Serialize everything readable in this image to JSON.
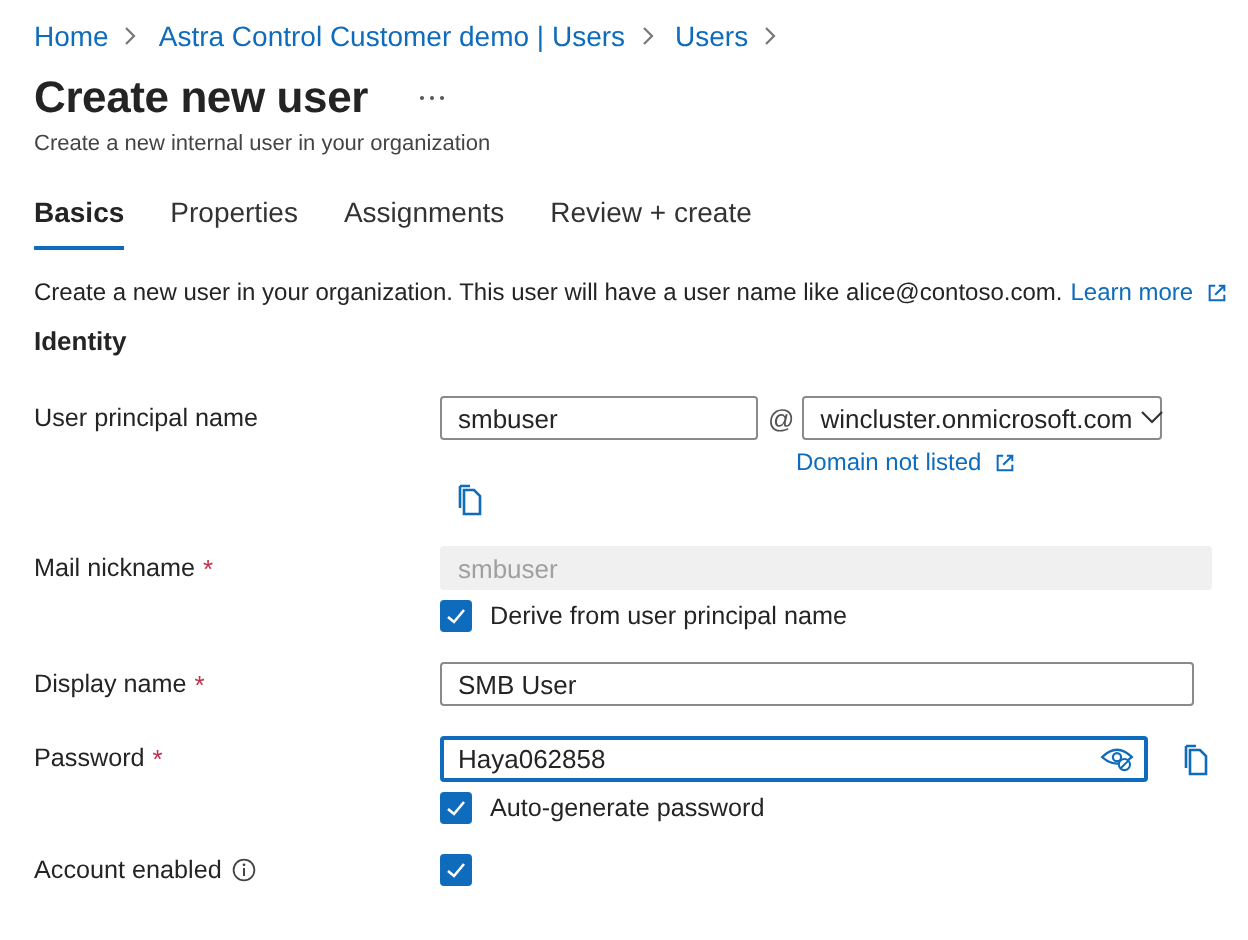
{
  "breadcrumb": [
    {
      "label": "Home"
    },
    {
      "label": "Astra Control Customer demo | Users"
    },
    {
      "label": "Users"
    }
  ],
  "title": "Create new user",
  "subtitle": "Create a new internal user in your organization",
  "tabs": [
    {
      "label": "Basics",
      "selected": true
    },
    {
      "label": "Properties",
      "selected": false
    },
    {
      "label": "Assignments",
      "selected": false
    },
    {
      "label": "Review + create",
      "selected": false
    }
  ],
  "intro": {
    "text": "Create a new user in your organization. This user will have a user name like alice@contoso.com.",
    "link": "Learn more"
  },
  "section": "Identity",
  "fields": [
    {
      "kind": "upn",
      "label": "User principal name",
      "value": "smbuser",
      "at": "@",
      "domain": "wincluster.onmicrosoft.com",
      "link": "Domain not listed"
    },
    {
      "kind": "text",
      "label": "Mail nickname",
      "required_mark": "*",
      "value": "smbuser",
      "disabled": true,
      "checkbox": {
        "label": "Derive from user principal name",
        "checked": true
      }
    },
    {
      "kind": "text",
      "label": "Display name",
      "required_mark": "*",
      "value": "SMB User",
      "disabled": false
    },
    {
      "kind": "password",
      "label": "Password",
      "required_mark": "*",
      "value": "Haya062858",
      "focused": true,
      "checkbox": {
        "label": "Auto-generate password",
        "checked": true
      }
    },
    {
      "kind": "checkbox",
      "label": "Account enabled",
      "info": true,
      "checked": true
    }
  ]
}
